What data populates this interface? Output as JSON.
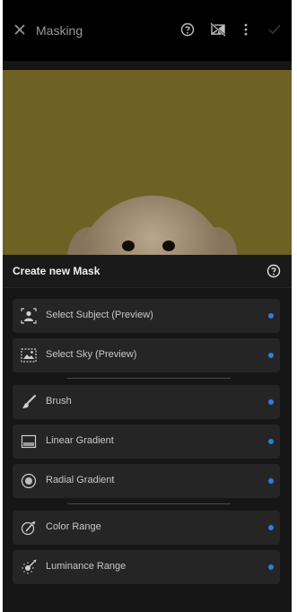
{
  "app": {
    "title": "Masking",
    "icons": [
      "close-icon",
      "help-icon",
      "compare-icon",
      "more-icon",
      "check-icon"
    ]
  },
  "panel": {
    "title": "Create new Mask",
    "items": [
      {
        "label": "Select Subject (Preview)",
        "icon": "person-select-icon"
      },
      {
        "label": "Select Sky (Preview)",
        "icon": "sky-select-icon"
      },
      {
        "label": "Brush",
        "icon": "brush-icon"
      },
      {
        "label": "Linear Gradient",
        "icon": "linear-gradient-icon"
      },
      {
        "label": "Radial Gradient",
        "icon": "radial-gradient-icon"
      },
      {
        "label": "Color Range",
        "icon": "color-range-icon"
      },
      {
        "label": "Luminance Range",
        "icon": "luminance-range-icon"
      }
    ]
  },
  "colors": {
    "accent_dot": "#2f7de1",
    "background": "#151515",
    "photo_background": "#6f6124"
  }
}
